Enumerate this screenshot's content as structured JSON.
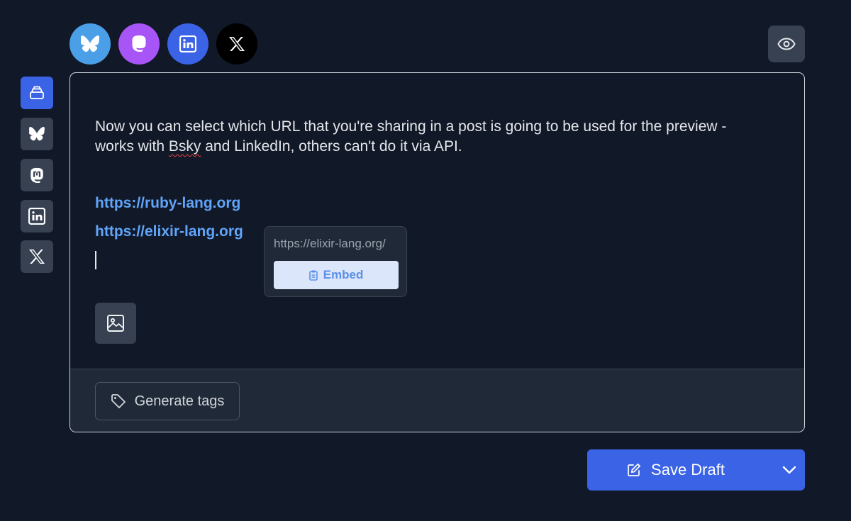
{
  "accounts": [
    {
      "name": "bluesky-avatar",
      "icon": "butterfly-icon",
      "color": "#4a9fe6"
    },
    {
      "name": "mastodon-avatar",
      "icon": "mastodon-icon",
      "color": "#a855f7"
    },
    {
      "name": "linkedin-avatar",
      "icon": "linkedin-icon",
      "color": "#3b63e6"
    },
    {
      "name": "x-avatar",
      "icon": "x-icon",
      "color": "#000000"
    }
  ],
  "sidebar": {
    "items": [
      {
        "name": "sidebar-item-all",
        "icon": "stack-icon",
        "active": true
      },
      {
        "name": "sidebar-item-bluesky",
        "icon": "butterfly-icon",
        "active": false
      },
      {
        "name": "sidebar-item-mastodon",
        "icon": "mastodon-icon",
        "active": false
      },
      {
        "name": "sidebar-item-linkedin",
        "icon": "linkedin-icon",
        "active": false
      },
      {
        "name": "sidebar-item-x",
        "icon": "x-icon",
        "active": false
      }
    ]
  },
  "editor": {
    "text_before": "Now you can select which URL that you're sharing in a post is going to be used for the preview - works with ",
    "misspelled_word": "Bsky",
    "text_after": " and LinkedIn, others can't do it via API.",
    "links": [
      "https://ruby-lang.org",
      "https://elixir-lang.org"
    ]
  },
  "popover": {
    "url": "https://elixir-lang.org/",
    "embed_label": "Embed"
  },
  "footer": {
    "generate_tags_label": "Generate tags"
  },
  "actions": {
    "save_label": "Save Draft"
  },
  "colors": {
    "background": "#111827",
    "accent": "#3b63e6",
    "link": "#60a5fa"
  }
}
